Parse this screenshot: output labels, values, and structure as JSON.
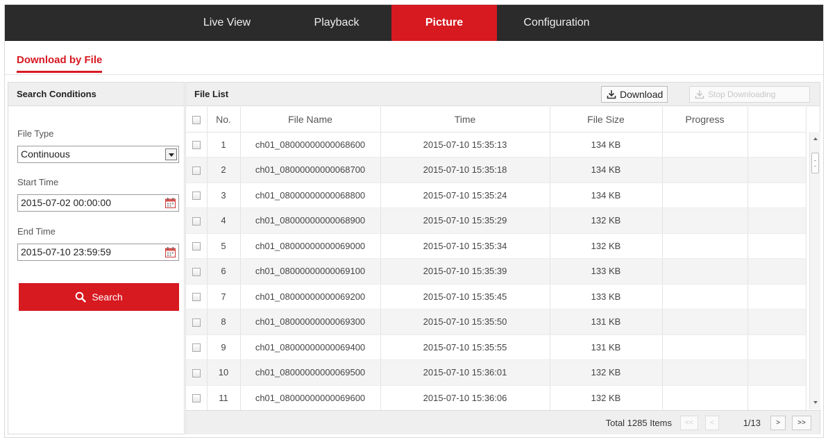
{
  "nav": {
    "tabs": [
      {
        "label": "Live View"
      },
      {
        "label": "Playback"
      },
      {
        "label": "Picture"
      },
      {
        "label": "Configuration"
      }
    ],
    "active_index": 2
  },
  "page_title": "Download by File",
  "search_conditions": {
    "title": "Search Conditions",
    "file_type_label": "File Type",
    "file_type_value": "Continuous",
    "start_time_label": "Start Time",
    "start_time_value": "2015-07-02 00:00:00",
    "end_time_label": "End Time",
    "end_time_value": "2015-07-10 23:59:59",
    "search_label": "Search"
  },
  "file_list": {
    "title": "File List",
    "download_label": "Download",
    "stop_downloading_label": "Stop Downloading",
    "columns": [
      "No.",
      "File Name",
      "Time",
      "File Size",
      "Progress"
    ],
    "rows": [
      {
        "no": "1",
        "name": "ch01_08000000000068600",
        "time": "2015-07-10 15:35:13",
        "size": "134 KB",
        "progress": ""
      },
      {
        "no": "2",
        "name": "ch01_08000000000068700",
        "time": "2015-07-10 15:35:18",
        "size": "134 KB",
        "progress": ""
      },
      {
        "no": "3",
        "name": "ch01_08000000000068800",
        "time": "2015-07-10 15:35:24",
        "size": "134 KB",
        "progress": ""
      },
      {
        "no": "4",
        "name": "ch01_08000000000068900",
        "time": "2015-07-10 15:35:29",
        "size": "132 KB",
        "progress": ""
      },
      {
        "no": "5",
        "name": "ch01_08000000000069000",
        "time": "2015-07-10 15:35:34",
        "size": "132 KB",
        "progress": ""
      },
      {
        "no": "6",
        "name": "ch01_08000000000069100",
        "time": "2015-07-10 15:35:39",
        "size": "133 KB",
        "progress": ""
      },
      {
        "no": "7",
        "name": "ch01_08000000000069200",
        "time": "2015-07-10 15:35:45",
        "size": "133 KB",
        "progress": ""
      },
      {
        "no": "8",
        "name": "ch01_08000000000069300",
        "time": "2015-07-10 15:35:50",
        "size": "131 KB",
        "progress": ""
      },
      {
        "no": "9",
        "name": "ch01_08000000000069400",
        "time": "2015-07-10 15:35:55",
        "size": "131 KB",
        "progress": ""
      },
      {
        "no": "10",
        "name": "ch01_08000000000069500",
        "time": "2015-07-10 15:36:01",
        "size": "132 KB",
        "progress": ""
      },
      {
        "no": "11",
        "name": "ch01_08000000000069600",
        "time": "2015-07-10 15:36:06",
        "size": "132 KB",
        "progress": ""
      }
    ]
  },
  "pagination": {
    "total_text": "Total 1285 Items",
    "first_label": "<<",
    "prev_label": "<",
    "page_text": "1/13",
    "next_label": ">",
    "last_label": ">>"
  },
  "colors": {
    "accent": "#d71920",
    "nav_background": "#2b2b2b",
    "header_background": "#efefef"
  },
  "icons": {
    "download": "download-icon",
    "stop_downloading": "stop-download-icon",
    "search": "search-icon",
    "calendar": "calendar-icon",
    "dropdown": "chevron-down-icon"
  }
}
